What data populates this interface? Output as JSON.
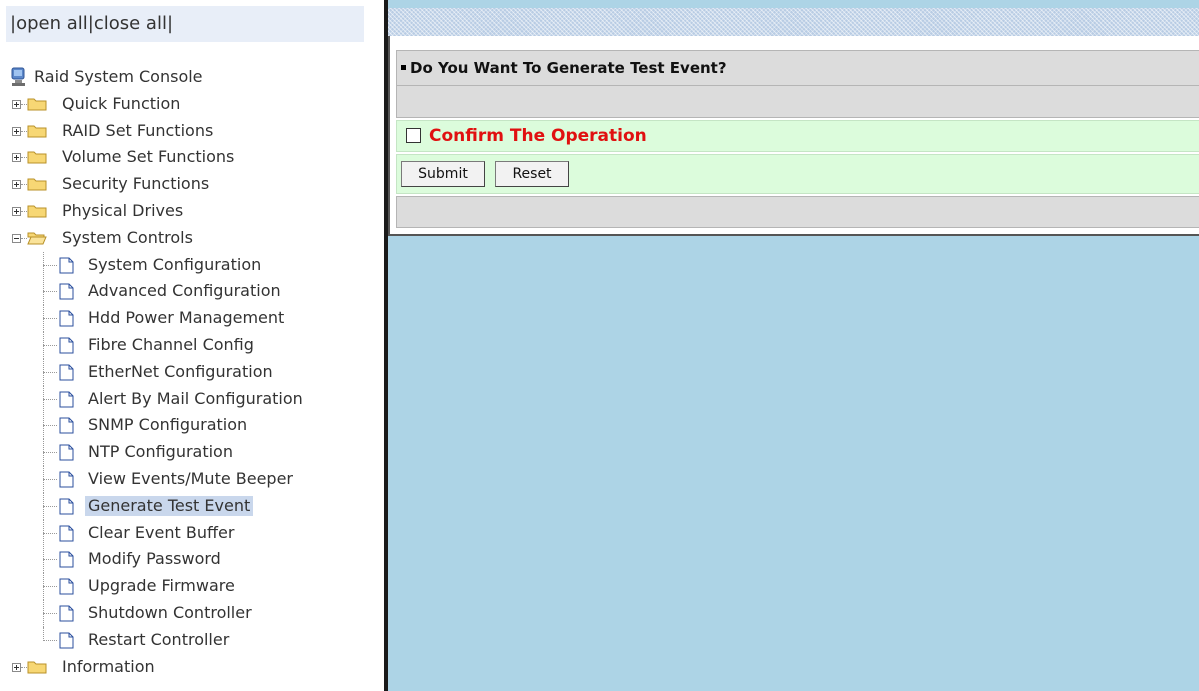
{
  "nav": {
    "open_all": "open all",
    "close_all": "close all",
    "root_label": "Raid System Console",
    "groups": [
      {
        "label": "Quick Function",
        "expanded": false
      },
      {
        "label": "RAID Set Functions",
        "expanded": false
      },
      {
        "label": "Volume Set Functions",
        "expanded": false
      },
      {
        "label": "Security Functions",
        "expanded": false
      },
      {
        "label": "Physical Drives",
        "expanded": false
      },
      {
        "label": "System Controls",
        "expanded": true
      },
      {
        "label": "Information",
        "expanded": false
      }
    ],
    "system_controls_items": [
      "System Configuration",
      "Advanced Configuration",
      "Hdd Power Management",
      "Fibre Channel Config",
      "EtherNet Configuration",
      "Alert By Mail Configuration",
      "SNMP Configuration",
      "NTP Configuration",
      "View Events/Mute Beeper",
      "Generate Test Event",
      "Clear Event Buffer",
      "Modify Password",
      "Upgrade Firmware",
      "Shutdown Controller",
      "Restart Controller"
    ],
    "selected_item": "Generate Test Event"
  },
  "main": {
    "header_title": "Do You Want To Generate Test Event?",
    "confirm_label": "Confirm The Operation",
    "confirm_checked": false,
    "submit_label": "Submit",
    "reset_label": "Reset"
  },
  "colors": {
    "main_background": "#add4e6",
    "header_gray": "#dcdcdc",
    "form_green": "#dcfcdc",
    "confirm_text": "#e01010",
    "selected_highlight": "#c9d7ec",
    "open_close_bar": "#e8eef8"
  },
  "icons": {
    "root": "computer-icon",
    "group": "folder-icon",
    "group_open": "folder-open-icon",
    "item": "document-icon",
    "expand": "plus-box-icon",
    "collapse": "minus-box-icon"
  }
}
